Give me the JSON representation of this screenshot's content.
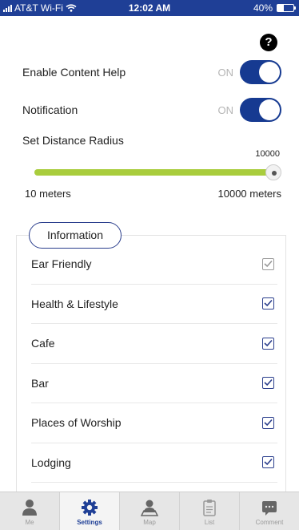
{
  "status_bar": {
    "carrier": "AT&T Wi-Fi",
    "time": "12:02 AM",
    "battery_text": "40%",
    "battery_level": 0.4
  },
  "help": {
    "icon": "question-icon",
    "glyph": "?"
  },
  "settings": {
    "content_help": {
      "label": "Enable Content Help",
      "state": "ON"
    },
    "notification": {
      "label": "Notification",
      "state": "ON"
    },
    "distance": {
      "label": "Set Distance Radius",
      "current_value": "10000",
      "min_label": "10 meters",
      "max_label": "10000 meters",
      "fill_fraction": 1.0
    }
  },
  "information": {
    "tab_label": "Information",
    "items": [
      {
        "label": "Ear Friendly",
        "checked": true,
        "style": "grey"
      },
      {
        "label": "Health & Lifestyle",
        "checked": true,
        "style": "blue"
      },
      {
        "label": "Cafe",
        "checked": true,
        "style": "blue"
      },
      {
        "label": "Bar",
        "checked": true,
        "style": "blue"
      },
      {
        "label": "Places of Worship",
        "checked": true,
        "style": "blue"
      },
      {
        "label": "Lodging",
        "checked": true,
        "style": "blue"
      }
    ]
  },
  "tab_bar": {
    "tabs": [
      {
        "label": "Me",
        "icon": "person-icon",
        "active": false
      },
      {
        "label": "Settings",
        "icon": "gear-icon",
        "active": true
      },
      {
        "label": "Map",
        "icon": "map-person-icon",
        "active": false
      },
      {
        "label": "List",
        "icon": "clipboard-icon",
        "active": false
      },
      {
        "label": "Comment",
        "icon": "comment-icon",
        "active": false
      }
    ]
  },
  "colors": {
    "accent": "#163a91",
    "slider": "#a9cd3d",
    "status_bar": "#1f3f96"
  }
}
